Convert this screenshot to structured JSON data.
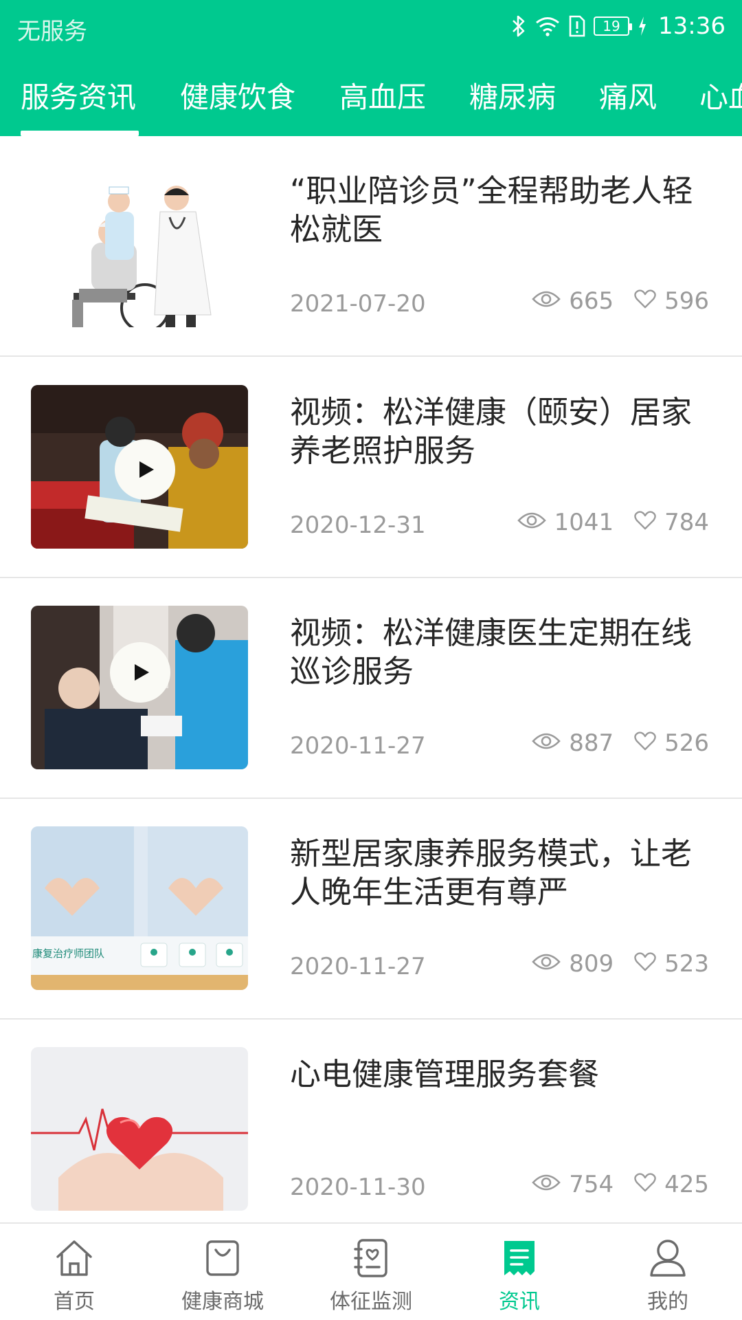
{
  "status_bar": {
    "carrier": "无服务",
    "battery": "19",
    "time": "13:36"
  },
  "tabs": [
    {
      "label": "服务资讯",
      "active": true
    },
    {
      "label": "健康饮食",
      "active": false
    },
    {
      "label": "高血压",
      "active": false
    },
    {
      "label": "糖尿病",
      "active": false
    },
    {
      "label": "痛风",
      "active": false
    },
    {
      "label": "心血",
      "active": false
    }
  ],
  "articles": [
    {
      "title": "“职业陪诊员”全程帮助老人轻松就医",
      "date": "2021-07-20",
      "views": "665",
      "likes": "596",
      "thumb": "nurse-doctor-wheelchair",
      "video": false
    },
    {
      "title": "视频：松洋健康（颐安）居家养老照护服务",
      "date": "2020-12-31",
      "views": "1041",
      "likes": "784",
      "thumb": "caregiver-reading",
      "video": true
    },
    {
      "title": "视频：松洋健康医生定期在线巡诊服务",
      "date": "2020-11-27",
      "views": "887",
      "likes": "526",
      "thumb": "doctor-checkup",
      "video": true
    },
    {
      "title": "新型居家康养服务模式，让老人晚年生活更有尊严",
      "date": "2020-11-27",
      "views": "809",
      "likes": "523",
      "thumb": "heart-hands-team",
      "video": false,
      "thumb_caption": "康复治疗师团队"
    },
    {
      "title": "心电健康管理服务套餐",
      "date": "2020-11-30",
      "views": "754",
      "likes": "425",
      "thumb": "heart-ecg",
      "video": false
    }
  ],
  "bottom_nav": [
    {
      "label": "首页",
      "icon": "home-icon",
      "active": false
    },
    {
      "label": "健康商城",
      "icon": "shopping-bag-icon",
      "active": false
    },
    {
      "label": "体征监测",
      "icon": "monitor-notebook-icon",
      "active": false
    },
    {
      "label": "资讯",
      "icon": "news-icon",
      "active": true
    },
    {
      "label": "我的",
      "icon": "user-icon",
      "active": false
    }
  ],
  "colors": {
    "primary": "#00c98f",
    "text": "#262626",
    "muted": "#9a9a9a",
    "nav_inactive": "#6b6b6b"
  }
}
